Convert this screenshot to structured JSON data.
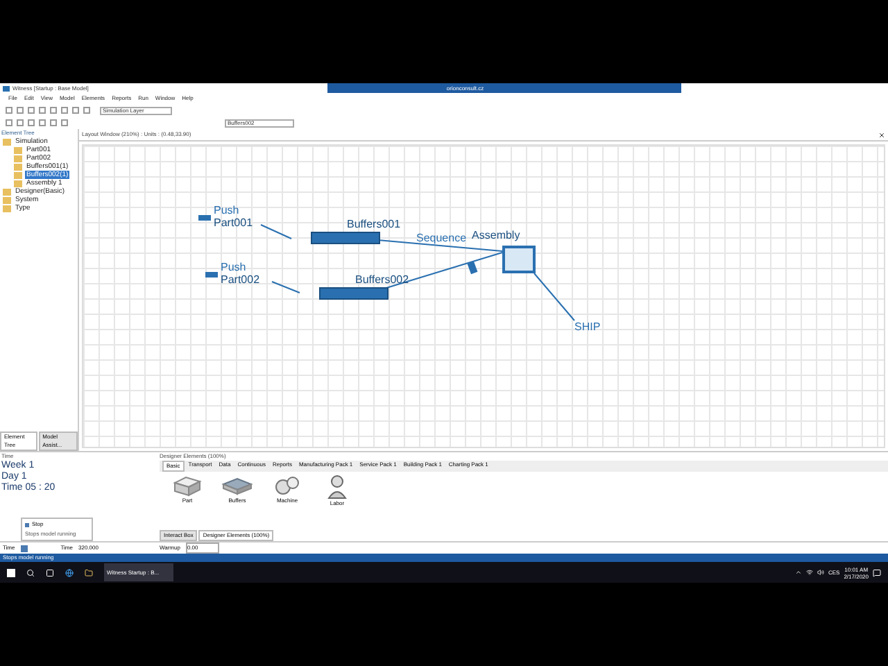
{
  "window": {
    "title": "Witness [Startup : Base Model]",
    "remote_banner": "orionconsult.cz"
  },
  "menu": [
    "File",
    "Edit",
    "View",
    "Model",
    "Elements",
    "Reports",
    "Run",
    "Window",
    "Help"
  ],
  "toolbar": {
    "layer": "Simulation Layer",
    "element": "Buffers002"
  },
  "element_tree": {
    "title": "Element Tree",
    "items": [
      {
        "label": "Simulation",
        "selected": false,
        "children": [
          {
            "label": "Part001",
            "selected": false
          },
          {
            "label": "Part002",
            "selected": false
          },
          {
            "label": "Buffers001(1)",
            "selected": false
          },
          {
            "label": "Buffers002(1)",
            "selected": true
          },
          {
            "label": "Assembly 1",
            "selected": false
          }
        ]
      },
      {
        "label": "Designer(Basic)",
        "selected": false
      },
      {
        "label": "System",
        "selected": false
      },
      {
        "label": "Type",
        "selected": false
      }
    ],
    "tabs": [
      {
        "label": "Element Tree",
        "selected": true
      },
      {
        "label": "Model Assist...",
        "selected": false
      }
    ]
  },
  "layout_window": {
    "title": "Layout Window (210%) : Units : (0.48,33.90)",
    "nodes": [
      {
        "kind": "part",
        "rule": "Push",
        "name": "Part001"
      },
      {
        "kind": "part",
        "rule": "Push",
        "name": "Part002"
      },
      {
        "kind": "buffer",
        "name": "Buffers001"
      },
      {
        "kind": "buffer",
        "name": "Buffers002"
      },
      {
        "kind": "machine",
        "name": "Assembly",
        "rule": "Sequence"
      },
      {
        "kind": "labor"
      },
      {
        "kind": "ship",
        "name": "SHIP"
      }
    ]
  },
  "time_panel": {
    "title": "Time",
    "lines": [
      "Week 1",
      "Day 1",
      "Time 05 : 20"
    ]
  },
  "designer": {
    "title": "Designer Elements (100%)",
    "tabs": [
      {
        "label": "Basic",
        "selected": true
      },
      {
        "label": "Transport",
        "selected": false
      },
      {
        "label": "Data",
        "selected": false
      },
      {
        "label": "Continuous",
        "selected": false
      },
      {
        "label": "Reports",
        "selected": false
      },
      {
        "label": "Manufacturing Pack 1",
        "selected": false
      },
      {
        "label": "Service Pack 1",
        "selected": false
      },
      {
        "label": "Building Pack 1",
        "selected": false
      },
      {
        "label": "Charting Pack 1",
        "selected": false
      }
    ],
    "items": [
      {
        "kind": "part",
        "label": "Part"
      },
      {
        "kind": "buffer",
        "label": "Buffers"
      },
      {
        "kind": "machine",
        "label": "Machine"
      },
      {
        "kind": "labor",
        "label": "Labor"
      }
    ],
    "bottom_tabs": [
      {
        "label": "Interact Box",
        "selected": false
      },
      {
        "label": "Designer Elements (100%)",
        "selected": true
      }
    ]
  },
  "run_bar": {
    "time_tab": "Time",
    "time_label": "Time",
    "time_value": "320.000",
    "warmup_label": "Warmup",
    "warmup_value": "0.00"
  },
  "tooltip": {
    "title": "Stop",
    "text": "Stops model running"
  },
  "status_bar": "Stops model running",
  "taskbar": {
    "app": "Witness Startup : B...",
    "time": "10:01 AM",
    "date": "2/17/2020",
    "lang": "CES"
  }
}
